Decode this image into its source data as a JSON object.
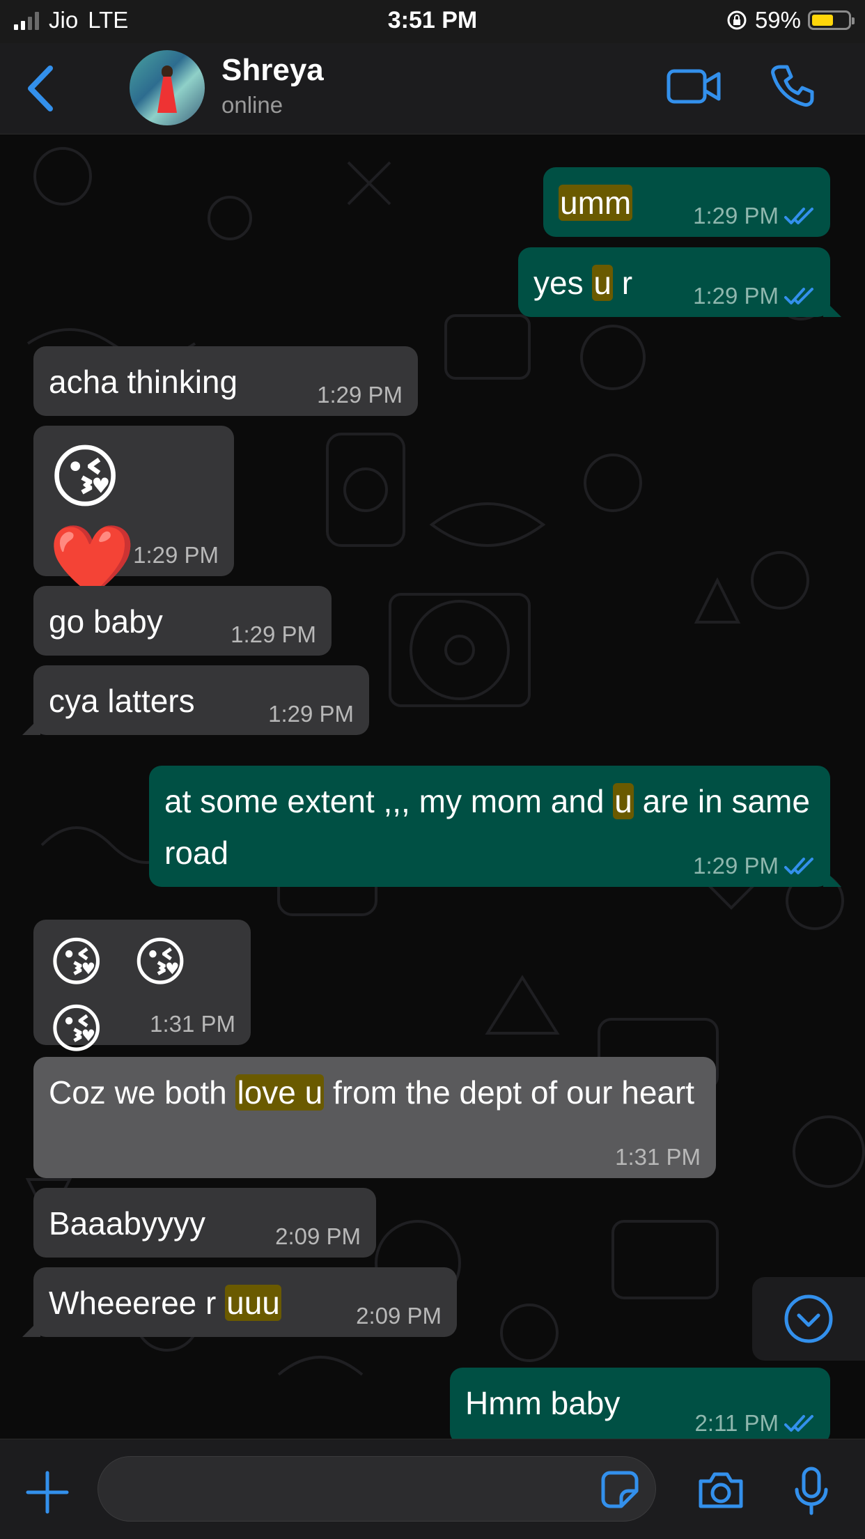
{
  "status_bar": {
    "carrier": "Jio",
    "network": "LTE",
    "time": "3:51 PM",
    "battery": "59%",
    "battery_level": 0.59
  },
  "header": {
    "contact_name": "Shreya",
    "contact_status": "online"
  },
  "messages": [
    {
      "dir": "out",
      "parts": [
        {
          "t": "umm",
          "hl": true
        }
      ],
      "time": "1:29 PM",
      "read": true
    },
    {
      "dir": "out",
      "parts": [
        {
          "t": "yes "
        },
        {
          "t": "u",
          "hl": true
        },
        {
          "t": " r"
        }
      ],
      "time": "1:29 PM",
      "read": true
    },
    {
      "dir": "in",
      "text": "acha thinking",
      "time": "1:29 PM"
    },
    {
      "dir": "in",
      "text": "😘 ❤️",
      "time": "1:29 PM"
    },
    {
      "dir": "in",
      "text": "go baby",
      "time": "1:29 PM"
    },
    {
      "dir": "in",
      "text": "cya latters",
      "time": "1:29 PM"
    },
    {
      "dir": "out",
      "parts": [
        {
          "t": "at some extent ,,, my mom and "
        },
        {
          "t": "u",
          "hl": true
        },
        {
          "t": " are in same road"
        }
      ],
      "time": "1:29 PM",
      "read": true
    },
    {
      "dir": "in",
      "text": "😘 😘 😘",
      "time": "1:31 PM"
    },
    {
      "dir": "in",
      "parts": [
        {
          "t": "Coz we both "
        },
        {
          "t": "love u",
          "hl": true
        },
        {
          "t": " from the dept of our heart"
        }
      ],
      "time": "1:31 PM"
    },
    {
      "dir": "in",
      "text": "Baaabyyyy",
      "time": "2:09 PM"
    },
    {
      "dir": "in",
      "parts": [
        {
          "t": "Wheeeree r "
        },
        {
          "t": "uuu",
          "hl": true
        }
      ],
      "time": "2:09 PM"
    },
    {
      "dir": "out",
      "text": "Hmm baby",
      "time": "2:11 PM",
      "read": true
    }
  ],
  "icons": {
    "back": "chevron-left-icon",
    "video": "video-camera-icon",
    "call": "phone-icon",
    "read_receipt": "double-check-icon",
    "scroll_down": "chevron-down-circle-icon",
    "attach": "plus-icon",
    "sticker": "sticker-icon",
    "camera": "camera-icon",
    "mic": "microphone-icon"
  },
  "colors": {
    "accent": "#3390ec",
    "outgoing_bubble": "#005044",
    "incoming_bubble": "#363638",
    "highlight": "#6a5a00"
  }
}
